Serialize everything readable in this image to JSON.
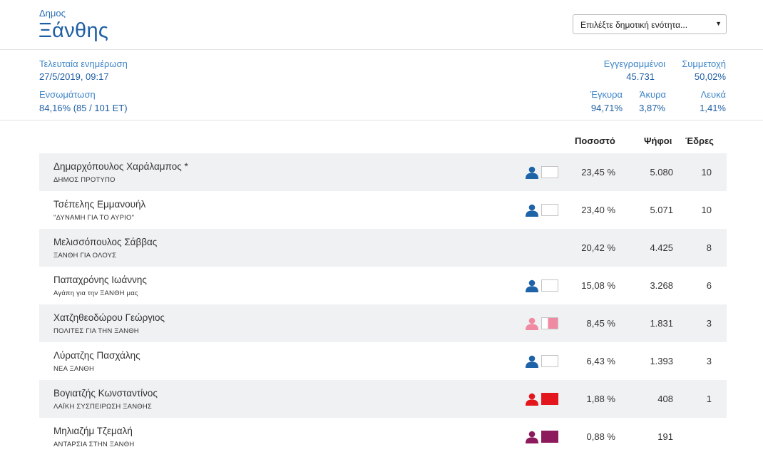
{
  "header": {
    "municipality_type": "Δημος",
    "municipality_name": "Ξάνθης",
    "unit_select": {
      "placeholder": "Επιλέξτε δημοτική ενότητα..."
    }
  },
  "stats": {
    "last_update_label": "Τελευταία ενημέρωση",
    "last_update_value": "27/5/2019, 09:17",
    "integration_label": "Ενσωμάτωση",
    "integration_value": "84,16% (85 / 101 ΕΤ)",
    "registered_label": "Εγγεγραμμένοι",
    "registered_value": "45.731",
    "turnout_label": "Συμμετοχή",
    "turnout_value": "50,02%",
    "valid_label": "Έγκυρα",
    "valid_value": "94,71%",
    "invalid_label": "Άκυρα",
    "invalid_value": "3,87%",
    "blank_label": "Λευκά",
    "blank_value": "1,41%"
  },
  "table": {
    "headers": {
      "percent": "Ποσοστό",
      "votes": "Ψήφοι",
      "seats": "Έδρες"
    },
    "rows": [
      {
        "candidate": "Δημαρχόπουλος Χαράλαμπος *",
        "party": "ΔΗΜΟΣ ΠΡΟΤΥΠΟ",
        "percent": "23,45 %",
        "votes": "5.080",
        "seats": "10",
        "icon": "person-icon",
        "icon_color": "#1e63a8",
        "box_color": "#ffffff"
      },
      {
        "candidate": "Τσέπελης Εμμανουήλ",
        "party": "\"ΔΥΝΑΜΗ ΓΙΑ ΤΟ ΑΥΡΙΟ\"",
        "percent": "23,40 %",
        "votes": "5.071",
        "seats": "10",
        "icon": "person-icon",
        "icon_color": "#1e63a8",
        "box_color": "#ffffff"
      },
      {
        "candidate": "Μελισσόπουλος Σάββας",
        "party": "ΞΑΝΘΗ ΓΙΑ ΟΛΟΥΣ",
        "percent": "20,42 %",
        "votes": "4.425",
        "seats": "8",
        "icon": "",
        "icon_color": "",
        "box_color": ""
      },
      {
        "candidate": "Παπαχρόνης Ιωάννης",
        "party": "Αγάπη για την ΞΑΝΘΗ μας",
        "percent": "15,08 %",
        "votes": "3.268",
        "seats": "6",
        "icon": "person-icon",
        "icon_color": "#1e63a8",
        "box_color": "#ffffff"
      },
      {
        "candidate": "Χατζηθεοδώρου Γεώργιος",
        "party": "ΠΟΛΙΤΕΣ ΓΙΑ ΤΗΝ ΞΑΝΘΗ",
        "percent": "8,45 %",
        "votes": "1.831",
        "seats": "3",
        "icon": "person-icon",
        "icon_color": "#f08aa0",
        "box_color": "#f08aa0"
      },
      {
        "candidate": "Λύρατζης Πασχάλης",
        "party": "ΝΕΑ ΞΑΝΘΗ",
        "percent": "6,43 %",
        "votes": "1.393",
        "seats": "3",
        "icon": "person-icon",
        "icon_color": "#1e63a8",
        "box_color": "#ffffff"
      },
      {
        "candidate": "Βογιατζής Κωνσταντίνος",
        "party": "ΛΑΪΚΗ ΣΥΣΠΕΙΡΩΣΗ ΞΑΝΘΗΣ",
        "percent": "1,88 %",
        "votes": "408",
        "seats": "1",
        "icon": "person-icon",
        "icon_color": "#e3161d",
        "box_color": "#e3161d"
      },
      {
        "candidate": "Μηλιαζήμ Τζεμαλή",
        "party": "ΑΝΤΑΡΣΙΑ ΣΤΗΝ ΞΑΝΘΗ",
        "percent": "0,88 %",
        "votes": "191",
        "seats": "",
        "icon": "person-icon",
        "icon_color": "#8c1a5c",
        "box_color": "#8c1a5c"
      }
    ]
  }
}
